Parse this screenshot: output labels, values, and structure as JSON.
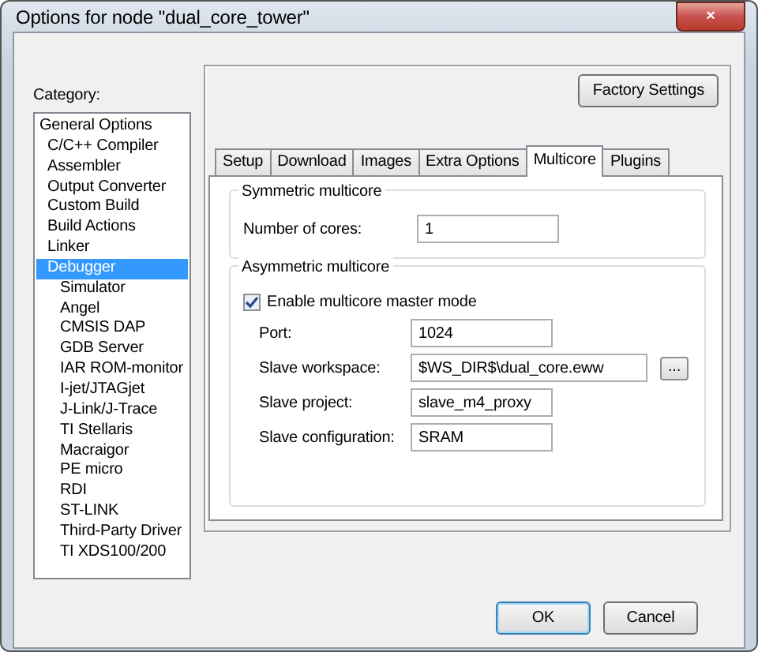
{
  "window": {
    "title": "Options for node \"dual_core_tower\"",
    "close": "×"
  },
  "category": {
    "label": "Category:",
    "items": [
      {
        "label": "General Options",
        "selected": false
      },
      {
        "label": "C/C++ Compiler",
        "selected": false
      },
      {
        "label": "Assembler",
        "selected": false
      },
      {
        "label": "Output Converter",
        "selected": false
      },
      {
        "label": "Custom Build",
        "selected": false
      },
      {
        "label": "Build Actions",
        "selected": false
      },
      {
        "label": "Linker",
        "selected": false
      },
      {
        "label": "Debugger",
        "selected": true,
        "children": [
          {
            "label": "Simulator",
            "selected": false
          },
          {
            "label": "Angel",
            "selected": false
          },
          {
            "label": "CMSIS DAP",
            "selected": false
          },
          {
            "label": "GDB Server",
            "selected": false
          },
          {
            "label": "IAR ROM-monitor",
            "selected": false
          },
          {
            "label": "I-jet/JTAGjet",
            "selected": false
          },
          {
            "label": "J-Link/J-Trace",
            "selected": false
          },
          {
            "label": "TI Stellaris",
            "selected": false
          },
          {
            "label": "Macraigor",
            "selected": false
          },
          {
            "label": "PE micro",
            "selected": false
          },
          {
            "label": "RDI",
            "selected": false
          },
          {
            "label": "ST-LINK",
            "selected": false
          },
          {
            "label": "Third-Party Driver",
            "selected": false
          },
          {
            "label": "TI XDS100/200",
            "selected": false
          }
        ]
      }
    ]
  },
  "factory_button": "Factory Settings",
  "tabs": [
    {
      "label": "Setup",
      "selected": false
    },
    {
      "label": "Download",
      "selected": false
    },
    {
      "label": "Images",
      "selected": false
    },
    {
      "label": "Extra Options",
      "selected": false
    },
    {
      "label": "Multicore",
      "selected": true
    },
    {
      "label": "Plugins",
      "selected": false
    }
  ],
  "symmetric": {
    "title": "Symmetric multicore",
    "label": "Number of cores:",
    "value": "1"
  },
  "asymmetric": {
    "title": "Asymmetric multicore",
    "checkbox": {
      "label": "Enable multicore master mode",
      "checked": true
    },
    "fields": [
      {
        "label": "Port:",
        "value": "1024",
        "kind": "short"
      },
      {
        "label": "Slave workspace:",
        "value": "$WS_DIR$\\dual_core.eww",
        "kind": "browse",
        "button": "..."
      },
      {
        "label": "Slave project:",
        "value": "slave_m4_proxy",
        "kind": "short"
      },
      {
        "label": "Slave configuration:",
        "value": "SRAM",
        "kind": "short"
      }
    ]
  },
  "buttons": [
    {
      "label": "OK",
      "default": true
    },
    {
      "label": "Cancel",
      "default": false
    }
  ]
}
